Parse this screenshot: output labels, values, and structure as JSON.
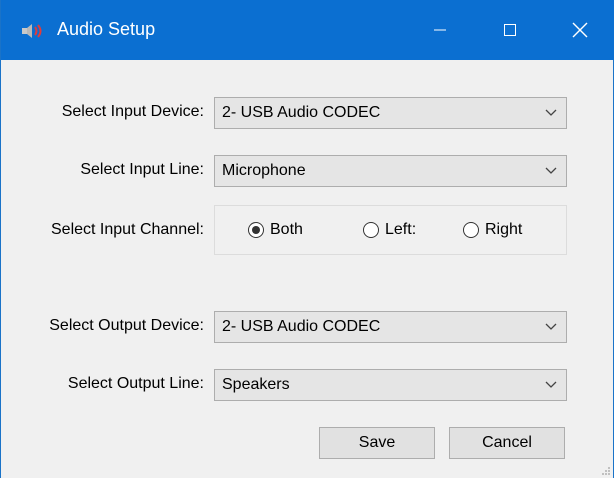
{
  "window": {
    "title": "Audio Setup",
    "icon": "speaker-icon",
    "accent_color": "#0b6fd1"
  },
  "titlebar_buttons": {
    "minimize": "minimize-icon",
    "maximize": "maximize-icon",
    "close": "close-icon"
  },
  "input_device": {
    "label": "Select Input Device:",
    "value": "2- USB Audio CODEC"
  },
  "input_line": {
    "label": "Select Input Line:",
    "value": "Microphone"
  },
  "input_channel": {
    "label": "Select Input Channel:",
    "options": [
      {
        "label": "Both",
        "checked": true
      },
      {
        "label": "Left:",
        "checked": false
      },
      {
        "label": "Right",
        "checked": false
      }
    ]
  },
  "output_device": {
    "label": "Select Output Device:",
    "value": "2- USB Audio CODEC"
  },
  "output_line": {
    "label": "Select Output Line:",
    "value": "Speakers"
  },
  "buttons": {
    "save": "Save",
    "cancel": "Cancel"
  }
}
